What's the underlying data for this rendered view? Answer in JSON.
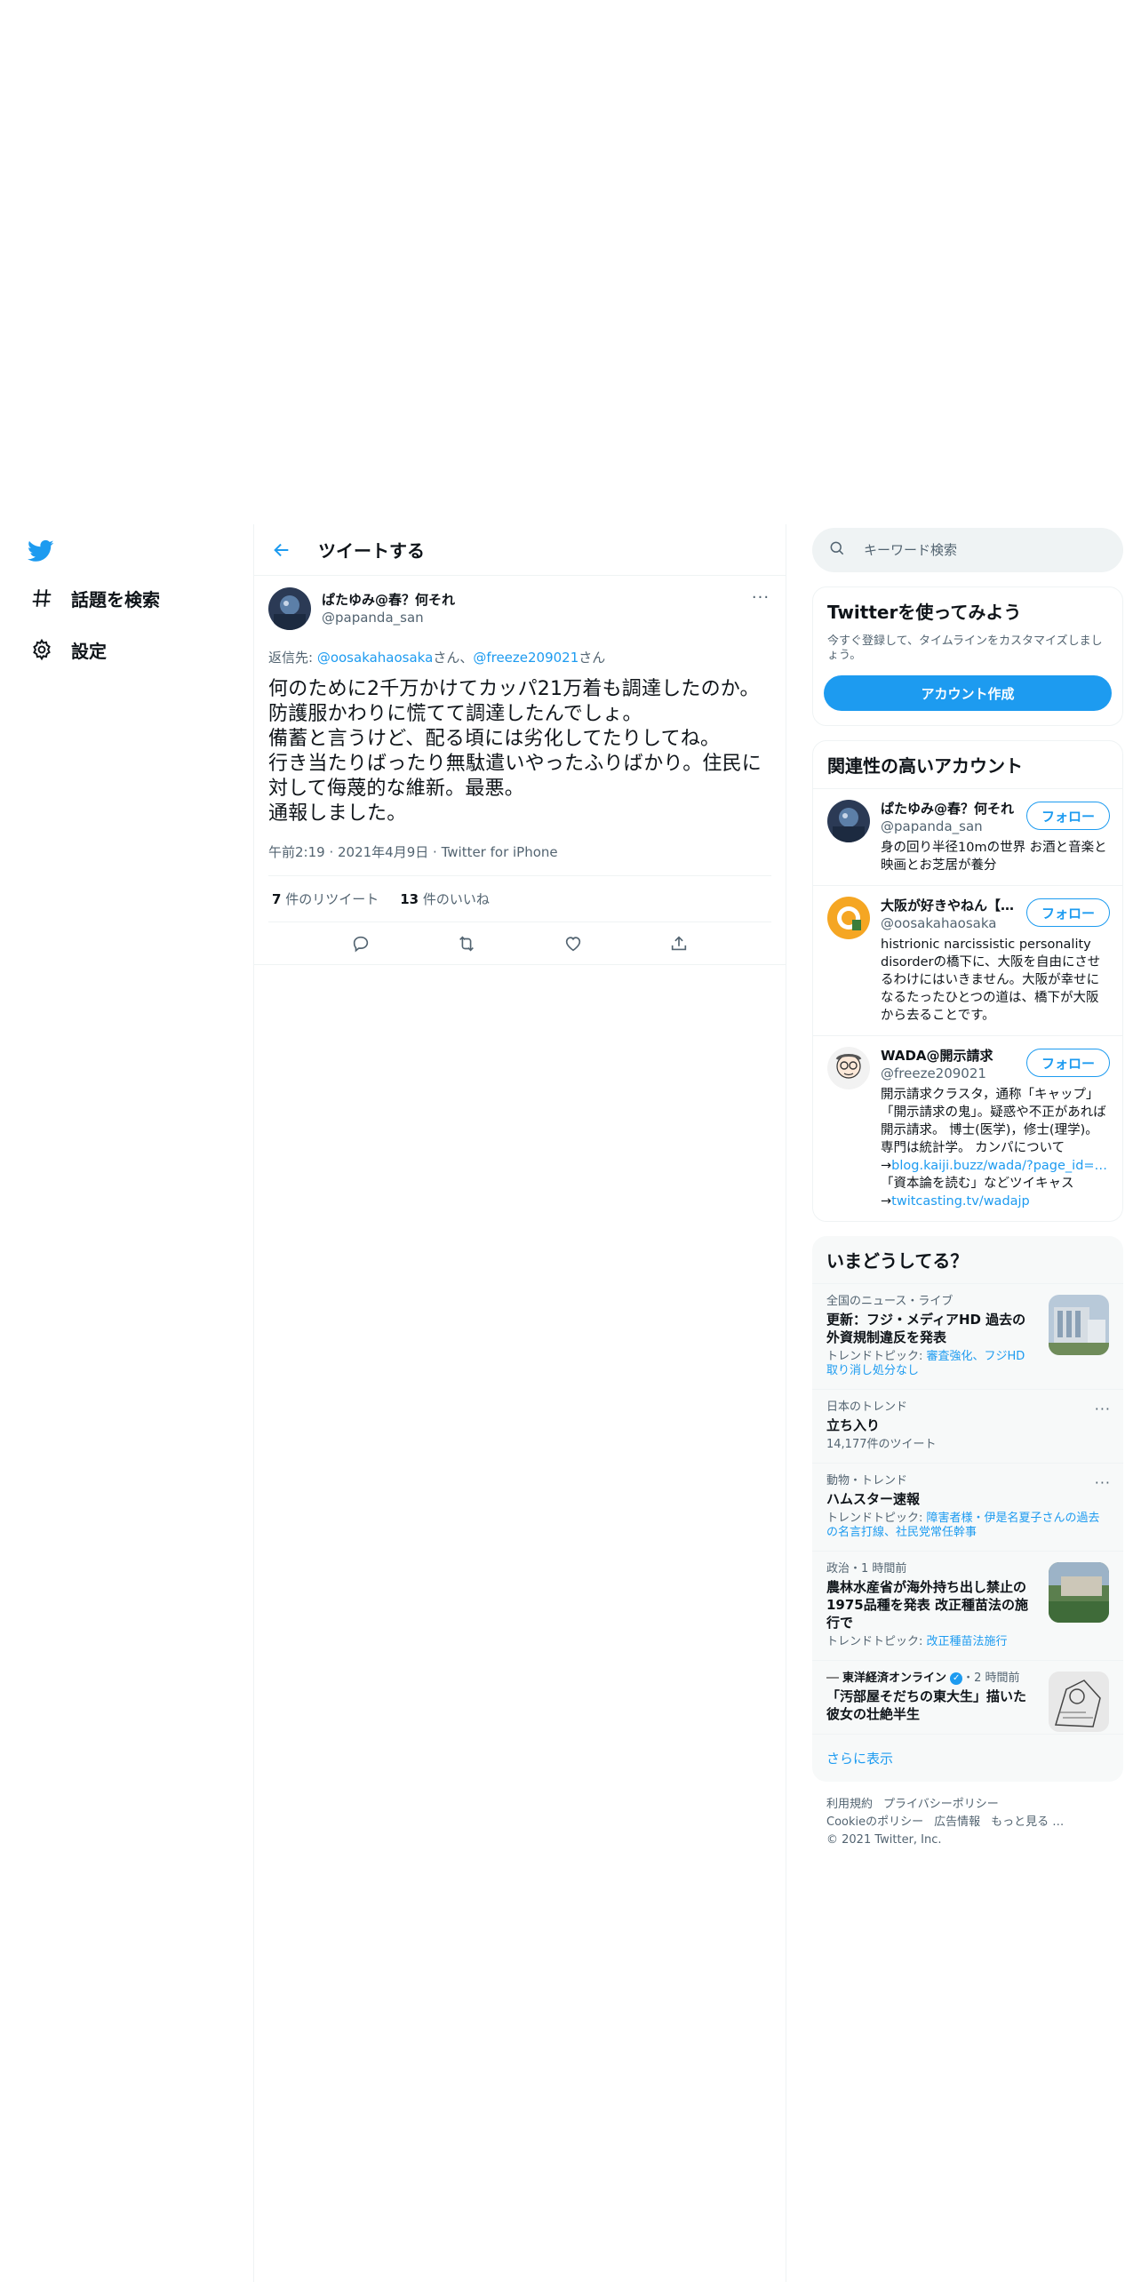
{
  "nav": {
    "explore_label": "話題を検索",
    "settings_label": "設定"
  },
  "header": {
    "title": "ツイートする"
  },
  "tweet": {
    "name": "ぱたゆみ@春？何それ",
    "handle": "@papanda_san",
    "reply_prefix": "返信先: ",
    "reply_user1": "@oosakahaosaka",
    "reply_suffix1": "さん、",
    "reply_user2": "@freeze209021",
    "reply_suffix2": "さん",
    "text": "何のために2千万かけてカッパ21万着も調達したのか。防護服かわりに慌てて調達したんでしょ。\n備蓄と言うけど、配る頃には劣化してたりしてね。\n行き当たりばったり無駄遣いやったふりばかり。住民に対して侮蔑的な維新。最悪。\n通報しました。",
    "time": "午前2:19",
    "date": "2021年4月9日",
    "source": "Twitter for iPhone",
    "retweets": "7",
    "retweets_label": " 件のリツイート",
    "likes": "13",
    "likes_label": " 件のいいね"
  },
  "search": {
    "placeholder": "キーワード検索"
  },
  "signup": {
    "title": "Twitterを使ってみよう",
    "desc": "今すぐ登録して、タイムラインをカスタマイズしましょう。",
    "button": "アカウント作成"
  },
  "related": {
    "title": "関連性の高いアカウント",
    "follow_label": "フォロー",
    "accounts": [
      {
        "name": "ぱたゆみ@春？何それ",
        "handle": "@papanda_san",
        "bio": "身の回り半径10mの世界 お酒と音楽と映画とお芝居が養分"
      },
      {
        "name": "大阪が好きやねん【…",
        "handle": "@oosakahaosaka",
        "bio": "histrionic narcissistic personality disorderの橋下に、大阪を自由にさせるわけにはいきません。大阪が幸せになるたったひとつの道は、橋下が大阪から去ることです。"
      },
      {
        "name": "WADA@開示請求",
        "handle": "@freeze209021",
        "bio": "開示請求クラスタ，通称「キャップ」「開示請求の鬼」。疑惑や不正があれば開示請求。 博士(医学)，修士(理学)。専門は統計学。 カンパについて",
        "link1_prefix": "→",
        "link1": "blog.kaiji.buzz/wada/?page_id=…",
        "bio2": "「資本論を読む」などツイキャス",
        "link2_prefix": "→",
        "link2": "twitcasting.tv/wadajp"
      }
    ]
  },
  "trends": {
    "title": "いまどうしてる？",
    "items": [
      {
        "context": "全国のニュース・ライブ",
        "title": "更新：フジ・メディアHD 過去の外資規制違反を発表",
        "sub_prefix": "トレンドトピック: ",
        "sub": "審査強化、フジHD取り消し処分なし"
      },
      {
        "context": "日本のトレンド",
        "title": "立ち入り",
        "count": "14,177件のツイート"
      },
      {
        "context": "動物・トレンド",
        "title": "ハムスター速報",
        "sub_prefix": "トレンドトピック: ",
        "sub": "障害者様・伊是名夏子さんの過去の名言打線、社民党常任幹事"
      },
      {
        "context": "政治・1 時間前",
        "title": "農林水産省が海外持ち出し禁止の1975品種を発表 改正種苗法の施行で",
        "sub_prefix": "トレンドトピック: ",
        "sub": "改正種苗法施行"
      },
      {
        "source": "東洋経済オンライン",
        "time": "・2 時間前",
        "title": "「汚部屋そだちの東大生」描いた彼女の壮絶半生"
      }
    ],
    "show_more": "さらに表示"
  },
  "footer": {
    "links_row1": [
      "利用規約",
      "プライバシーポリシー"
    ],
    "links_row2": [
      "Cookieのポリシー",
      "広告情報",
      "もっと見る …"
    ],
    "copyright": "© 2021 Twitter, Inc."
  },
  "colors": {
    "accent": "#1d9bf0",
    "text": "#0f1419",
    "muted": "#536471",
    "border": "#eff3f4"
  }
}
